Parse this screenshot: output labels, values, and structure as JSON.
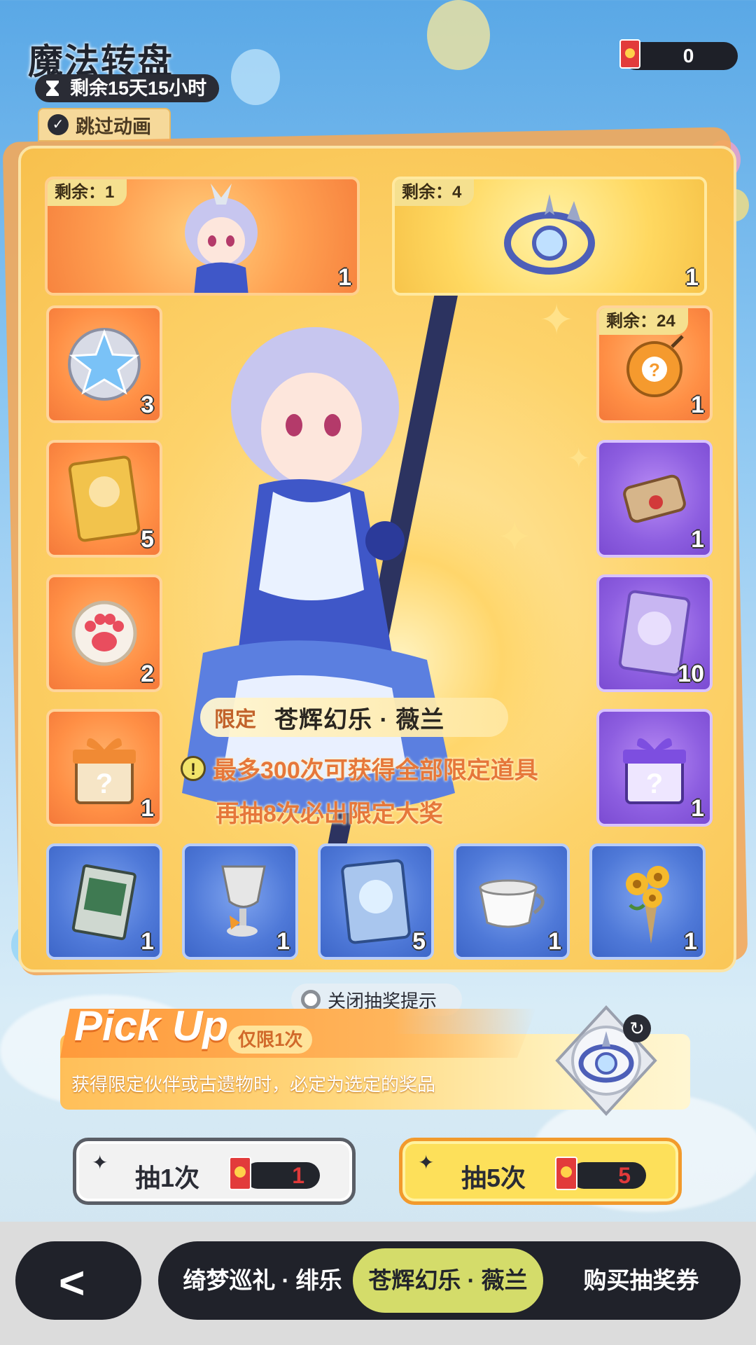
{
  "header": {
    "title": "魔法转盘",
    "timer": "剩余15天15小时",
    "ticket_count": "0",
    "skip_label": "跳过动画"
  },
  "board": {
    "top_left": {
      "remain": "剩余：1",
      "qty": "1"
    },
    "top_right": {
      "remain": "剩余：4",
      "qty": "1"
    },
    "left_column": [
      {
        "qty": "3"
      },
      {
        "qty": "5"
      },
      {
        "qty": "2"
      },
      {
        "qty": "1"
      }
    ],
    "right_column": [
      {
        "remain": "剩余：24",
        "qty": "1"
      },
      {
        "qty": "1"
      },
      {
        "qty": "10"
      },
      {
        "qty": "1"
      }
    ],
    "bottom_row": [
      {
        "qty": "1"
      },
      {
        "qty": "1"
      },
      {
        "qty": "5"
      },
      {
        "qty": "1"
      },
      {
        "qty": "1"
      }
    ],
    "limited_tag": "限定",
    "limited_name": "苍辉幻乐 · 薇兰",
    "info_line1": "最多300次可获得全部限定道具",
    "info_line2": "再抽8次必出限定大奖"
  },
  "toggle_label": "关闭抽奖提示",
  "pickup": {
    "title": "Pick Up",
    "badge": "仅限1次",
    "description": "获得限定伙伴或古遗物时，必定为选定的奖品"
  },
  "draw_one": {
    "label": "抽1次",
    "cost": "1"
  },
  "draw_five": {
    "label": "抽5次",
    "cost": "5"
  },
  "tabs": [
    "绮梦巡礼 · 绯乐",
    "苍辉幻乐 · 薇兰",
    "购买抽奖券"
  ],
  "colors": {
    "accent_orange": "#ff9a3b",
    "active_tab": "#d4dc6a",
    "cost_red": "#e03a3a"
  }
}
